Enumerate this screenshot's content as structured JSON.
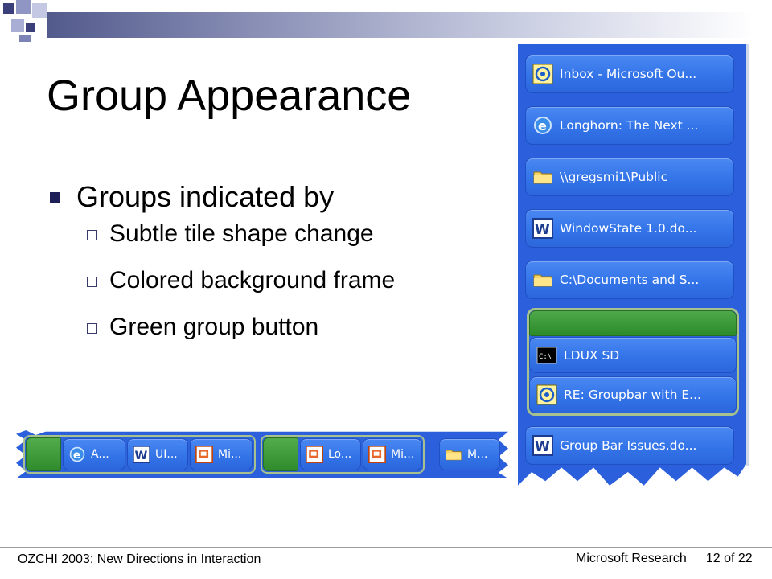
{
  "slide": {
    "title": "Group Appearance",
    "bullet": "Groups indicated by",
    "sub_bullets": [
      "Subtle tile shape change",
      "Colored background frame",
      "Green group button"
    ]
  },
  "vertical_groupbar": {
    "tiles": [
      {
        "label": "Inbox - Microsoft Ou...",
        "icon": "outlook-icon"
      },
      {
        "label": "Longhorn: The Next ...",
        "icon": "internet-explorer-icon"
      },
      {
        "label": "\\\\gregsmi1\\Public",
        "icon": "folder-icon"
      },
      {
        "label": "WindowState 1.0.do...",
        "icon": "word-icon"
      },
      {
        "label": "C:\\Documents and S...",
        "icon": "folder-icon"
      },
      {
        "label": "LDUX SD",
        "icon": "command-prompt-icon"
      },
      {
        "label": "RE: Groupbar with E...",
        "icon": "outlook-icon"
      },
      {
        "label": "Group Bar Issues.do...",
        "icon": "word-icon"
      }
    ]
  },
  "horizontal_groupbar": {
    "tiles": [
      {
        "label": "A...",
        "icon": "internet-explorer-icon"
      },
      {
        "label": "UI...",
        "icon": "word-icon"
      },
      {
        "label": "Mi...",
        "icon": "powerpoint-icon"
      },
      {
        "label": "Lo...",
        "icon": "powerpoint-icon"
      },
      {
        "label": "Mi...",
        "icon": "powerpoint-icon"
      },
      {
        "label": "M...",
        "icon": "folder-icon"
      }
    ]
  },
  "footer": {
    "left": "OZCHI 2003: New Directions in Interaction",
    "org": "Microsoft Research",
    "page": "12 of 22"
  },
  "colors": {
    "bar_blue": "#2b5fdc",
    "tile_blue": "#3374e8",
    "group_green": "#2c8a2a",
    "group_frame": "#a6c08e",
    "title_band": "#525a8c"
  }
}
